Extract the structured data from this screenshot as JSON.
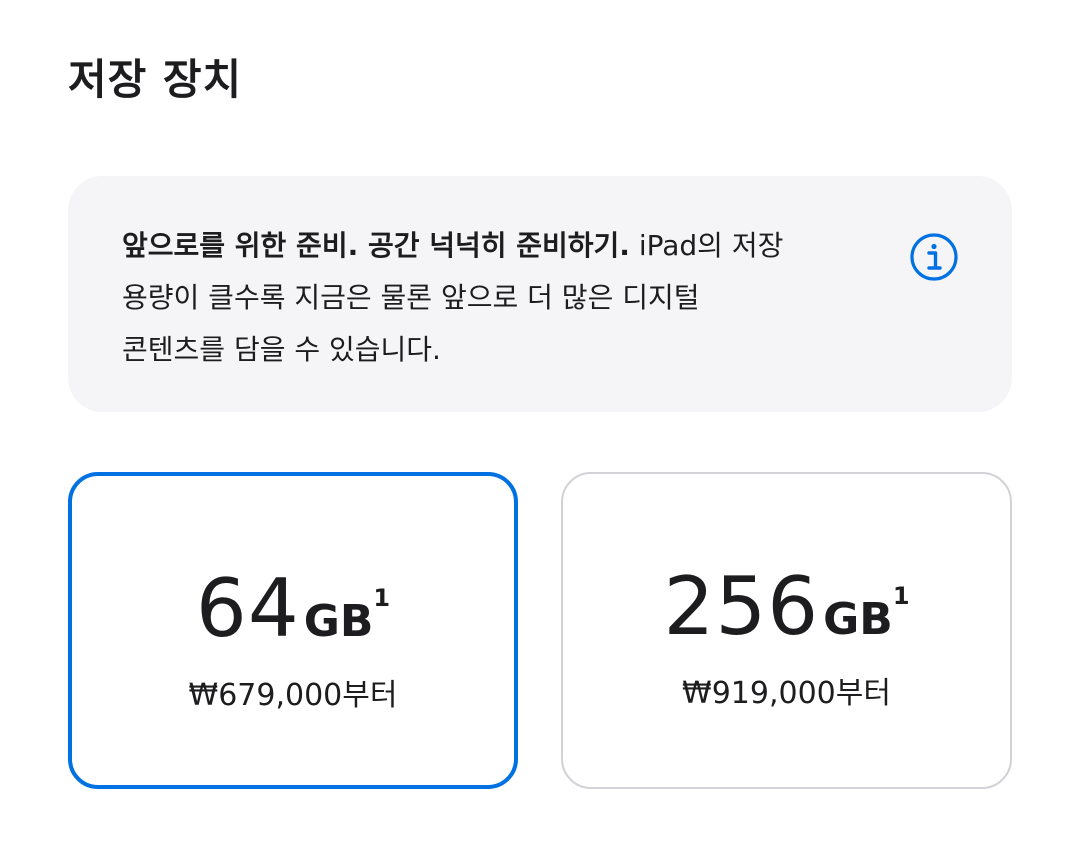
{
  "section": {
    "title": "저장 장치"
  },
  "info": {
    "headline": "앞으로를 위한 준비. 공간 넉넉히 준비하기.",
    "body_line1": " iPad의 저장",
    "body_line2": "용량이 클수록 지금은 물론 앞으로 더 많은 디지털",
    "body_line3": "콘텐츠를 담을 수 있습니다.",
    "icon": "info-circle-icon"
  },
  "options": [
    {
      "capacity": "64",
      "unit": "GB",
      "footnote": "1",
      "price": "₩679,000부터",
      "selected": true
    },
    {
      "capacity": "256",
      "unit": "GB",
      "footnote": "1",
      "price": "₩919,000부터",
      "selected": false
    }
  ],
  "colors": {
    "accent": "#0071e3",
    "card_background": "#f5f5f7",
    "unselected_border": "#d2d2d7",
    "text": "#1d1d1f"
  }
}
